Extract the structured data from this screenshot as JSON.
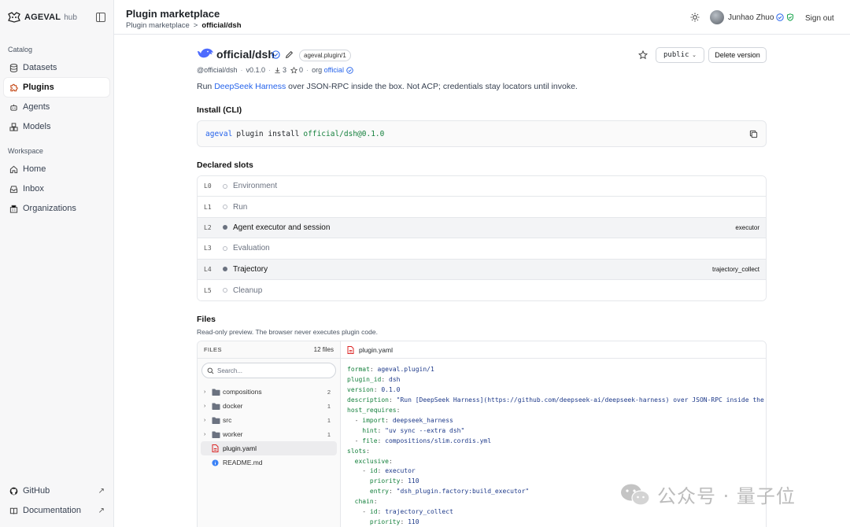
{
  "brand": {
    "name": "AGEVAL",
    "sub": "hub"
  },
  "sidebar": {
    "catalog_label": "Catalog",
    "catalog_items": [
      {
        "label": "Datasets",
        "icon": "database-icon"
      },
      {
        "label": "Plugins",
        "icon": "puzzle-icon",
        "active": true
      },
      {
        "label": "Agents",
        "icon": "bot-icon"
      },
      {
        "label": "Models",
        "icon": "boxes-icon"
      }
    ],
    "workspace_label": "Workspace",
    "workspace_items": [
      {
        "label": "Home",
        "icon": "home-icon"
      },
      {
        "label": "Inbox",
        "icon": "inbox-icon"
      },
      {
        "label": "Organizations",
        "icon": "building-icon"
      }
    ],
    "footer_items": [
      {
        "label": "GitHub",
        "icon": "github-icon"
      },
      {
        "label": "Documentation",
        "icon": "book-icon"
      }
    ]
  },
  "header": {
    "title": "Plugin marketplace",
    "breadcrumb": {
      "root": "Plugin marketplace",
      "separator": ">",
      "current": "official/dsh"
    },
    "user_name": "Junhao Zhuo",
    "sign_out": "Sign out"
  },
  "plugin": {
    "name": "official/dsh",
    "kind": "ageval.plugin/1",
    "visibility": "public",
    "delete_label": "Delete version",
    "meta": {
      "handle": "@official/dsh",
      "version": "v0.1.0",
      "downloads": "3",
      "stars": "0",
      "org_prefix": "org",
      "org": "official"
    },
    "description": {
      "prefix": "Run ",
      "link": "DeepSeek Harness",
      "suffix": " over JSON-RPC inside the box. Not ACP; credentials stay locators until invoke."
    }
  },
  "install": {
    "title": "Install (CLI)",
    "bin": "ageval",
    "sub": "plugin install",
    "arg": "official/dsh@0.1.0"
  },
  "slots": {
    "title": "Declared slots",
    "rows": [
      {
        "level": "L0",
        "name": "Environment",
        "impl": "",
        "on": false
      },
      {
        "level": "L1",
        "name": "Run",
        "impl": "",
        "on": false
      },
      {
        "level": "L2",
        "name": "Agent executor and session",
        "impl": "executor",
        "on": true
      },
      {
        "level": "L3",
        "name": "Evaluation",
        "impl": "",
        "on": false
      },
      {
        "level": "L4",
        "name": "Trajectory",
        "impl": "trajectory_collect",
        "on": true
      },
      {
        "level": "L5",
        "name": "Cleanup",
        "impl": "",
        "on": false
      }
    ]
  },
  "files": {
    "title": "Files",
    "subtitle": "Read-only preview. The browser never executes plugin code.",
    "tree_header": "FILES",
    "count": "12 files",
    "search_placeholder": "Search...",
    "items": [
      {
        "name": "compositions",
        "type": "folder",
        "n": "2"
      },
      {
        "name": "docker",
        "type": "folder",
        "n": "1"
      },
      {
        "name": "src",
        "type": "folder",
        "n": "1"
      },
      {
        "name": "worker",
        "type": "folder",
        "n": "1"
      },
      {
        "name": "plugin.yaml",
        "type": "yaml",
        "n": ""
      },
      {
        "name": "README.md",
        "type": "md",
        "n": ""
      }
    ],
    "open_file": "plugin.yaml",
    "code": [
      [
        [
          "k",
          "format"
        ],
        [
          "p",
          ": "
        ],
        [
          "v",
          "ageval.plugin/1"
        ]
      ],
      [
        [
          "k",
          "plugin_id"
        ],
        [
          "p",
          ": "
        ],
        [
          "v",
          "dsh"
        ]
      ],
      [
        [
          "k",
          "version"
        ],
        [
          "p",
          ": "
        ],
        [
          "v",
          "0.1.0"
        ]
      ],
      [
        [
          "k",
          "description"
        ],
        [
          "p",
          ": "
        ],
        [
          "v",
          "\"Run [DeepSeek Harness](https://github.com/deepseek-ai/deepseek-harness) over JSON-RPC inside the box"
        ]
      ],
      [
        [
          "k",
          "host_requires"
        ],
        [
          "p",
          ":"
        ]
      ],
      [
        [
          "p",
          "  - "
        ],
        [
          "k",
          "import"
        ],
        [
          "p",
          ": "
        ],
        [
          "v",
          "deepseek_harness"
        ]
      ],
      [
        [
          "p",
          "    "
        ],
        [
          "k",
          "hint"
        ],
        [
          "p",
          ": "
        ],
        [
          "v",
          "\"uv sync --extra dsh\""
        ]
      ],
      [
        [
          "p",
          "  - "
        ],
        [
          "k",
          "file"
        ],
        [
          "p",
          ": "
        ],
        [
          "v",
          "compositions/slim.cordis.yml"
        ]
      ],
      [
        [
          "k",
          "slots"
        ],
        [
          "p",
          ":"
        ]
      ],
      [
        [
          "p",
          "  "
        ],
        [
          "k",
          "exclusive"
        ],
        [
          "p",
          ":"
        ]
      ],
      [
        [
          "p",
          "    - "
        ],
        [
          "k",
          "id"
        ],
        [
          "p",
          ": "
        ],
        [
          "v",
          "executor"
        ]
      ],
      [
        [
          "p",
          "      "
        ],
        [
          "k",
          "priority"
        ],
        [
          "p",
          ": "
        ],
        [
          "v",
          "110"
        ]
      ],
      [
        [
          "p",
          "      "
        ],
        [
          "k",
          "entry"
        ],
        [
          "p",
          ": "
        ],
        [
          "v",
          "\"dsh_plugin.factory:build_executor\""
        ]
      ],
      [
        [
          "p",
          "  "
        ],
        [
          "k",
          "chain"
        ],
        [
          "p",
          ":"
        ]
      ],
      [
        [
          "p",
          "    - "
        ],
        [
          "k",
          "id"
        ],
        [
          "p",
          ": "
        ],
        [
          "v",
          "trajectory_collect"
        ]
      ],
      [
        [
          "p",
          "      "
        ],
        [
          "k",
          "priority"
        ],
        [
          "p",
          ": "
        ],
        [
          "v",
          "110"
        ]
      ]
    ]
  },
  "watermark": "公众号 · 量子位"
}
